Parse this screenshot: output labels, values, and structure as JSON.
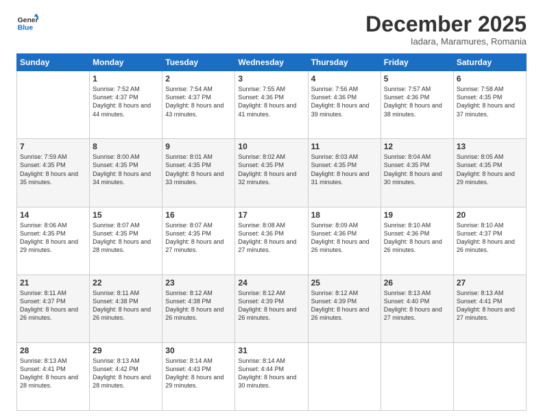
{
  "logo": {
    "line1": "General",
    "line2": "Blue"
  },
  "title": "December 2025",
  "location": "Iadara, Maramures, Romania",
  "days_of_week": [
    "Sunday",
    "Monday",
    "Tuesday",
    "Wednesday",
    "Thursday",
    "Friday",
    "Saturday"
  ],
  "weeks": [
    [
      {
        "day": "",
        "sunrise": "",
        "sunset": "",
        "daylight": ""
      },
      {
        "day": "1",
        "sunrise": "Sunrise: 7:52 AM",
        "sunset": "Sunset: 4:37 PM",
        "daylight": "Daylight: 8 hours and 44 minutes."
      },
      {
        "day": "2",
        "sunrise": "Sunrise: 7:54 AM",
        "sunset": "Sunset: 4:37 PM",
        "daylight": "Daylight: 8 hours and 43 minutes."
      },
      {
        "day": "3",
        "sunrise": "Sunrise: 7:55 AM",
        "sunset": "Sunset: 4:36 PM",
        "daylight": "Daylight: 8 hours and 41 minutes."
      },
      {
        "day": "4",
        "sunrise": "Sunrise: 7:56 AM",
        "sunset": "Sunset: 4:36 PM",
        "daylight": "Daylight: 8 hours and 39 minutes."
      },
      {
        "day": "5",
        "sunrise": "Sunrise: 7:57 AM",
        "sunset": "Sunset: 4:36 PM",
        "daylight": "Daylight: 8 hours and 38 minutes."
      },
      {
        "day": "6",
        "sunrise": "Sunrise: 7:58 AM",
        "sunset": "Sunset: 4:35 PM",
        "daylight": "Daylight: 8 hours and 37 minutes."
      }
    ],
    [
      {
        "day": "7",
        "sunrise": "Sunrise: 7:59 AM",
        "sunset": "Sunset: 4:35 PM",
        "daylight": "Daylight: 8 hours and 35 minutes."
      },
      {
        "day": "8",
        "sunrise": "Sunrise: 8:00 AM",
        "sunset": "Sunset: 4:35 PM",
        "daylight": "Daylight: 8 hours and 34 minutes."
      },
      {
        "day": "9",
        "sunrise": "Sunrise: 8:01 AM",
        "sunset": "Sunset: 4:35 PM",
        "daylight": "Daylight: 8 hours and 33 minutes."
      },
      {
        "day": "10",
        "sunrise": "Sunrise: 8:02 AM",
        "sunset": "Sunset: 4:35 PM",
        "daylight": "Daylight: 8 hours and 32 minutes."
      },
      {
        "day": "11",
        "sunrise": "Sunrise: 8:03 AM",
        "sunset": "Sunset: 4:35 PM",
        "daylight": "Daylight: 8 hours and 31 minutes."
      },
      {
        "day": "12",
        "sunrise": "Sunrise: 8:04 AM",
        "sunset": "Sunset: 4:35 PM",
        "daylight": "Daylight: 8 hours and 30 minutes."
      },
      {
        "day": "13",
        "sunrise": "Sunrise: 8:05 AM",
        "sunset": "Sunset: 4:35 PM",
        "daylight": "Daylight: 8 hours and 29 minutes."
      }
    ],
    [
      {
        "day": "14",
        "sunrise": "Sunrise: 8:06 AM",
        "sunset": "Sunset: 4:35 PM",
        "daylight": "Daylight: 8 hours and 29 minutes."
      },
      {
        "day": "15",
        "sunrise": "Sunrise: 8:07 AM",
        "sunset": "Sunset: 4:35 PM",
        "daylight": "Daylight: 8 hours and 28 minutes."
      },
      {
        "day": "16",
        "sunrise": "Sunrise: 8:07 AM",
        "sunset": "Sunset: 4:35 PM",
        "daylight": "Daylight: 8 hours and 27 minutes."
      },
      {
        "day": "17",
        "sunrise": "Sunrise: 8:08 AM",
        "sunset": "Sunset: 4:36 PM",
        "daylight": "Daylight: 8 hours and 27 minutes."
      },
      {
        "day": "18",
        "sunrise": "Sunrise: 8:09 AM",
        "sunset": "Sunset: 4:36 PM",
        "daylight": "Daylight: 8 hours and 26 minutes."
      },
      {
        "day": "19",
        "sunrise": "Sunrise: 8:10 AM",
        "sunset": "Sunset: 4:36 PM",
        "daylight": "Daylight: 8 hours and 26 minutes."
      },
      {
        "day": "20",
        "sunrise": "Sunrise: 8:10 AM",
        "sunset": "Sunset: 4:37 PM",
        "daylight": "Daylight: 8 hours and 26 minutes."
      }
    ],
    [
      {
        "day": "21",
        "sunrise": "Sunrise: 8:11 AM",
        "sunset": "Sunset: 4:37 PM",
        "daylight": "Daylight: 8 hours and 26 minutes."
      },
      {
        "day": "22",
        "sunrise": "Sunrise: 8:11 AM",
        "sunset": "Sunset: 4:38 PM",
        "daylight": "Daylight: 8 hours and 26 minutes."
      },
      {
        "day": "23",
        "sunrise": "Sunrise: 8:12 AM",
        "sunset": "Sunset: 4:38 PM",
        "daylight": "Daylight: 8 hours and 26 minutes."
      },
      {
        "day": "24",
        "sunrise": "Sunrise: 8:12 AM",
        "sunset": "Sunset: 4:39 PM",
        "daylight": "Daylight: 8 hours and 26 minutes."
      },
      {
        "day": "25",
        "sunrise": "Sunrise: 8:12 AM",
        "sunset": "Sunset: 4:39 PM",
        "daylight": "Daylight: 8 hours and 26 minutes."
      },
      {
        "day": "26",
        "sunrise": "Sunrise: 8:13 AM",
        "sunset": "Sunset: 4:40 PM",
        "daylight": "Daylight: 8 hours and 27 minutes."
      },
      {
        "day": "27",
        "sunrise": "Sunrise: 8:13 AM",
        "sunset": "Sunset: 4:41 PM",
        "daylight": "Daylight: 8 hours and 27 minutes."
      }
    ],
    [
      {
        "day": "28",
        "sunrise": "Sunrise: 8:13 AM",
        "sunset": "Sunset: 4:41 PM",
        "daylight": "Daylight: 8 hours and 28 minutes."
      },
      {
        "day": "29",
        "sunrise": "Sunrise: 8:13 AM",
        "sunset": "Sunset: 4:42 PM",
        "daylight": "Daylight: 8 hours and 28 minutes."
      },
      {
        "day": "30",
        "sunrise": "Sunrise: 8:14 AM",
        "sunset": "Sunset: 4:43 PM",
        "daylight": "Daylight: 8 hours and 29 minutes."
      },
      {
        "day": "31",
        "sunrise": "Sunrise: 8:14 AM",
        "sunset": "Sunset: 4:44 PM",
        "daylight": "Daylight: 8 hours and 30 minutes."
      },
      {
        "day": "",
        "sunrise": "",
        "sunset": "",
        "daylight": ""
      },
      {
        "day": "",
        "sunrise": "",
        "sunset": "",
        "daylight": ""
      },
      {
        "day": "",
        "sunrise": "",
        "sunset": "",
        "daylight": ""
      }
    ]
  ]
}
